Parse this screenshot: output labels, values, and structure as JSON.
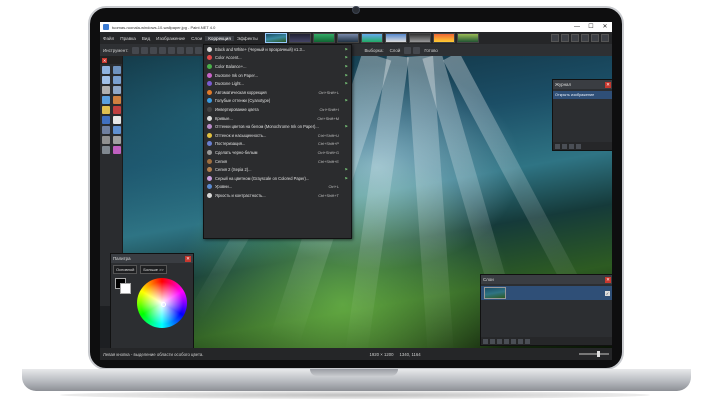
{
  "app": {
    "title": "tuomas-ruonala-windows-10-wallpaper.jpg - Paint.NET 4.0"
  },
  "window_controls": {
    "minimize": "—",
    "maximize": "☐",
    "close": "✕"
  },
  "menubar": {
    "items": [
      "Файл",
      "Правка",
      "Вид",
      "Изображение",
      "Слои",
      "Коррекция",
      "Эффекты"
    ],
    "active_index": 5
  },
  "toolbar": {
    "tool_label": "Инструмент:",
    "selection_label": "Выборка:",
    "layer_label": "Слой",
    "done_label": "Готово"
  },
  "tools_panel": {
    "close": "✕"
  },
  "adjustments_menu": {
    "items": [
      {
        "label": "Black and White+ (Черный и прозрачный) v1.3...",
        "shortcut": "",
        "flag": "⚑",
        "icon_color": "#d6d6d6"
      },
      {
        "label": "Color Accent...",
        "shortcut": "",
        "flag": "⚑",
        "icon_color": "#e24a4a"
      },
      {
        "label": "Color Balance+...",
        "shortcut": "",
        "flag": "⚑",
        "icon_color": "#4ab04a"
      },
      {
        "label": "Duotone Ink on Paper...",
        "shortcut": "",
        "flag": "⚑",
        "icon_color": "#c864c8"
      },
      {
        "label": "Duotone Light...",
        "shortcut": "",
        "flag": "⚑",
        "icon_color": "#7a5bd0"
      },
      {
        "label": "Автоматическая коррекция",
        "shortcut": "Ctrl+Shift+L",
        "flag": "",
        "icon_color": "#e07b2a"
      },
      {
        "label": "Голубые оттенки (Cyanotype)",
        "shortcut": "",
        "flag": "⚑",
        "icon_color": "#3b9be0"
      },
      {
        "label": "Инвертирование цвета",
        "shortcut": "Ctrl+Shift+I",
        "flag": "",
        "icon_color": "#444444"
      },
      {
        "label": "Кривые...",
        "shortcut": "Ctrl+Shift+M",
        "flag": "",
        "icon_color": "#dddddd"
      },
      {
        "label": "Оттенки цветов на белом (Monochrome Ink on Paper)...",
        "shortcut": "",
        "flag": "⚑",
        "icon_color": "#b88ac8"
      },
      {
        "label": "Оттенок и насыщенность...",
        "shortcut": "Ctrl+Shift+U",
        "flag": "",
        "icon_color": "#e0c040"
      },
      {
        "label": "Постеризация...",
        "shortcut": "Ctrl+Shift+P",
        "flag": "",
        "icon_color": "#6a7fd0"
      },
      {
        "label": "Сделать черно-белым",
        "shortcut": "Ctrl+Shift+G",
        "flag": "",
        "icon_color": "#9a9a9a"
      },
      {
        "label": "Сепия",
        "shortcut": "Ctrl+Shift+E",
        "flag": "",
        "icon_color": "#a07040"
      },
      {
        "label": "Сепия 2 (Sepia 2)...",
        "shortcut": "",
        "flag": "⚑",
        "icon_color": "#b08050"
      },
      {
        "label": "Серый на цветном (Grayscale on Colored Paper)...",
        "shortcut": "",
        "flag": "⚑",
        "icon_color": "#c8a0e0"
      },
      {
        "label": "Уровни...",
        "shortcut": "Ctrl+L",
        "flag": "",
        "icon_color": "#5a8ad0"
      },
      {
        "label": "Яркость и контрастность...",
        "shortcut": "Ctrl+Shift+T",
        "flag": "",
        "icon_color": "#d8d8d8"
      }
    ]
  },
  "history_panel": {
    "title": "Журнал",
    "close": "✕",
    "entries": [
      "Открыть изображение"
    ]
  },
  "palette_panel": {
    "title": "Палитра",
    "close": "✕",
    "primary_select": "Основной",
    "more_button": "Больше >>"
  },
  "layers_panel": {
    "title": "Слои",
    "close": "✕",
    "layer_check": "✓"
  },
  "statusbar": {
    "hint": "Левая кнопка - выделение области особого цвета.",
    "image_size": "1920 × 1200",
    "cursor_pos": "1340, 1164"
  },
  "colors": {
    "accent": "#2f4f77",
    "panel_bg": "#2c2e31",
    "menu_bg": "#252628",
    "close_red": "#c8382f"
  }
}
